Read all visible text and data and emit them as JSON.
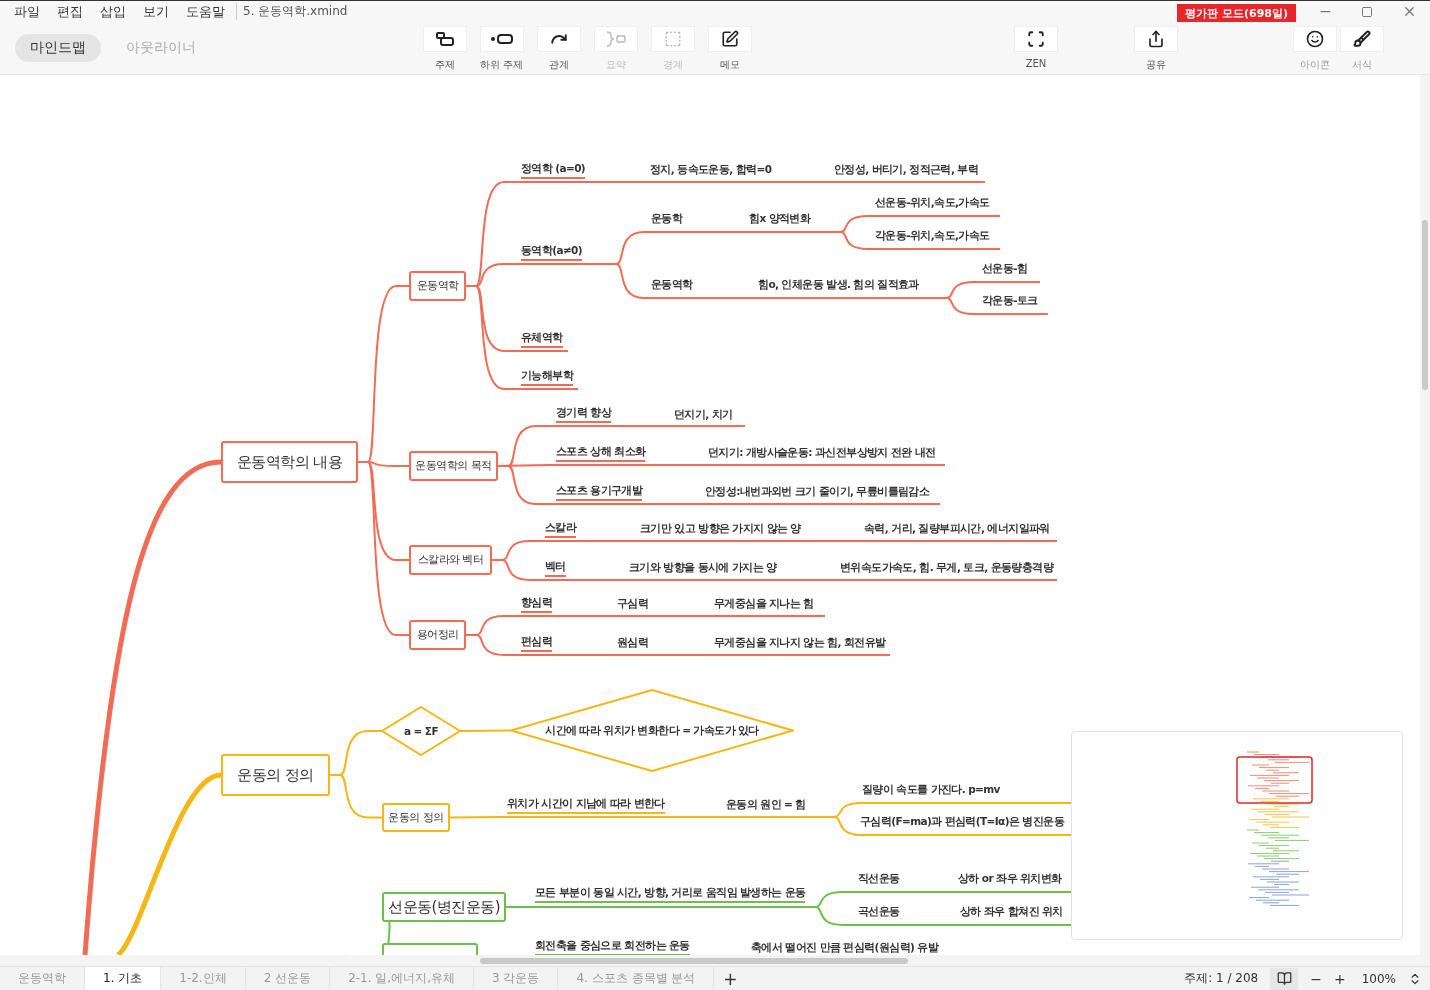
{
  "menu": [
    "파일",
    "편집",
    "삽입",
    "보기",
    "도움말"
  ],
  "file_name": "5. 운동역학.xmind",
  "trial_badge": "평가판 모드(698일)",
  "view_modes": [
    {
      "label": "마인드맵",
      "selected": true
    },
    {
      "label": "아웃라이너",
      "selected": false
    }
  ],
  "insert_tools": [
    {
      "kind": "topic",
      "label": "주제",
      "disabled": false
    },
    {
      "kind": "subtopic",
      "label": "하위 주제",
      "disabled": false
    },
    {
      "kind": "relation",
      "label": "관계",
      "disabled": false
    },
    {
      "kind": "summary",
      "label": "요약",
      "disabled": true
    },
    {
      "kind": "boundary",
      "label": "경계",
      "disabled": true
    },
    {
      "kind": "note",
      "label": "메모",
      "disabled": false
    }
  ],
  "view_tools": [
    {
      "kind": "zen",
      "label": "ZEN"
    },
    {
      "kind": "share",
      "label": "공유"
    }
  ],
  "panel_tools": [
    {
      "kind": "icons",
      "label": "아이콘"
    },
    {
      "kind": "format",
      "label": "서식"
    }
  ],
  "mind_map": {
    "branches": [
      {
        "color": "#f26b55",
        "topics": [
          {
            "kind": "box",
            "text": "운동역학의 내용",
            "children": [
              {
                "kind": "box",
                "text": "운동역학",
                "children": [
                  {
                    "kind": "topic",
                    "text": "정역학 (a=0)",
                    "children": [
                      {
                        "kind": "plain",
                        "text": "정지, 등속도운동, 합력=0",
                        "children": [
                          {
                            "kind": "plain",
                            "text": "안정성, 버티기, 정적근력, 부력"
                          }
                        ]
                      }
                    ]
                  },
                  {
                    "kind": "topic",
                    "text": "동역학(a≠0)",
                    "children": [
                      {
                        "kind": "plain",
                        "text": "운동학",
                        "children": [
                          {
                            "kind": "plain",
                            "text": "힘x 양적변화",
                            "children": [
                              {
                                "kind": "plain",
                                "text": "선운동-위치,속도,가속도"
                              },
                              {
                                "kind": "plain",
                                "text": "각운동-위치,속도,가속도"
                              }
                            ]
                          }
                        ]
                      },
                      {
                        "kind": "plain",
                        "text": "운동역학",
                        "children": [
                          {
                            "kind": "plain",
                            "text": "힘o, 인체운동 발생. 힘의 질적효과",
                            "children": [
                              {
                                "kind": "plain",
                                "text": "선운동-힘"
                              },
                              {
                                "kind": "plain",
                                "text": "각운동-토크"
                              }
                            ]
                          }
                        ]
                      }
                    ]
                  },
                  {
                    "kind": "topic",
                    "text": "유체역학"
                  },
                  {
                    "kind": "topic",
                    "text": "기능해부학"
                  }
                ]
              },
              {
                "kind": "box",
                "text": "운동역학의 목적",
                "children": [
                  {
                    "kind": "topic",
                    "text": "경기력 향상",
                    "children": [
                      {
                        "kind": "plain",
                        "text": "던지기, 치기"
                      }
                    ]
                  },
                  {
                    "kind": "topic",
                    "text": "스포츠 상해 최소화",
                    "children": [
                      {
                        "kind": "plain",
                        "text": "던지기: 개방사슬운동: 과신전부상방지 전완 내전"
                      }
                    ]
                  },
                  {
                    "kind": "topic",
                    "text": "스포츠 용기구개발",
                    "children": [
                      {
                        "kind": "plain",
                        "text": "안정성:내번과외번 크기 줄이기, 무릎비틀림감소"
                      }
                    ]
                  }
                ]
              },
              {
                "kind": "box",
                "text": "스칼라와 벡터",
                "children": [
                  {
                    "kind": "topic",
                    "text": "스칼라",
                    "children": [
                      {
                        "kind": "plain",
                        "text": "크기만 있고 방향은 가지지 않는 양",
                        "children": [
                          {
                            "kind": "plain",
                            "text": "속력, 거리, 질량부피시간, 에너지일파워"
                          }
                        ]
                      }
                    ]
                  },
                  {
                    "kind": "topic",
                    "text": "벡터",
                    "children": [
                      {
                        "kind": "plain",
                        "text": "크기와 방향을 동시에 가지는 양",
                        "children": [
                          {
                            "kind": "plain",
                            "text": "변위속도가속도, 힘. 무게, 토크, 운동량충격량"
                          }
                        ]
                      }
                    ]
                  }
                ]
              },
              {
                "kind": "box",
                "text": "용어정리",
                "children": [
                  {
                    "kind": "topic",
                    "text": "향심력",
                    "children": [
                      {
                        "kind": "plain",
                        "text": "구심력",
                        "children": [
                          {
                            "kind": "plain",
                            "text": "무게중심을 지나는 힘"
                          }
                        ]
                      }
                    ]
                  },
                  {
                    "kind": "topic",
                    "text": "편심력",
                    "children": [
                      {
                        "kind": "plain",
                        "text": "원심력",
                        "children": [
                          {
                            "kind": "plain",
                            "text": "무게중심을 지나지 않는 힘, 회전유발"
                          }
                        ]
                      }
                    ]
                  }
                ]
              }
            ]
          }
        ]
      },
      {
        "color": "#f5b715",
        "topics": [
          {
            "kind": "box",
            "text": "운동의 정의",
            "children": [
              {
                "kind": "diamond",
                "text": "a = ΣF",
                "children": [
                  {
                    "kind": "diamond",
                    "text": "시간에 따라 위치가 변화한다 = 가속도가 있다"
                  }
                ]
              },
              {
                "kind": "box",
                "text": "운동의 정의",
                "children": [
                  {
                    "kind": "topic",
                    "text": "위치가 시간이 지남에 따라 변한다",
                    "children": [
                      {
                        "kind": "plain",
                        "text": "운동의 원인 = 힘",
                        "children": [
                          {
                            "kind": "plain",
                            "text": "질량이 속도를 가진다.  p=mv"
                          },
                          {
                            "kind": "plain",
                            "text": "구심력(F=ma)과 편심력(T=Iα)은 병진운동"
                          }
                        ]
                      }
                    ]
                  }
                ]
              }
            ]
          }
        ]
      },
      {
        "color": "#6dbf4b",
        "topics": [
          {
            "kind": "box",
            "text": "선운동(병진운동)",
            "children": [
              {
                "kind": "topic",
                "text": "모든 부분이 동일 시간, 방향, 거리로 움직임 발생하는 운동",
                "children": [
                  {
                    "kind": "plain",
                    "text": "직선운동",
                    "children": [
                      {
                        "kind": "plain",
                        "text": "상하 or 좌우 위치변화"
                      }
                    ]
                  },
                  {
                    "kind": "plain",
                    "text": "곡선운동",
                    "children": [
                      {
                        "kind": "plain",
                        "text": "상하 좌우 합쳐진 위치"
                      }
                    ]
                  }
                ]
              }
            ]
          },
          {
            "kind": "box",
            "children": [
              {
                "kind": "topic",
                "text": "회전축을 중심으로 회전하는 운동",
                "children": [
                  {
                    "kind": "plain",
                    "text": "축에서 떨어진 만큼 편심력(원심력) 유발"
                  }
                ]
              }
            ]
          }
        ]
      }
    ]
  },
  "sheet_tabs": [
    {
      "label": "운동역학",
      "selected": false
    },
    {
      "label": "1. 기초",
      "selected": true
    },
    {
      "label": "1-2.인체",
      "selected": false
    },
    {
      "label": "2 선운동",
      "selected": false
    },
    {
      "label": "2-1. 일,에너지,유체",
      "selected": false
    },
    {
      "label": "3 각운동",
      "selected": false
    },
    {
      "label": "4. 스포츠 종목별 분석",
      "selected": false
    }
  ],
  "add_sheet": "+",
  "topic_count": "주제: 1 / 208",
  "zoom_out": "−",
  "zoom_in": "+",
  "zoom": "100%"
}
